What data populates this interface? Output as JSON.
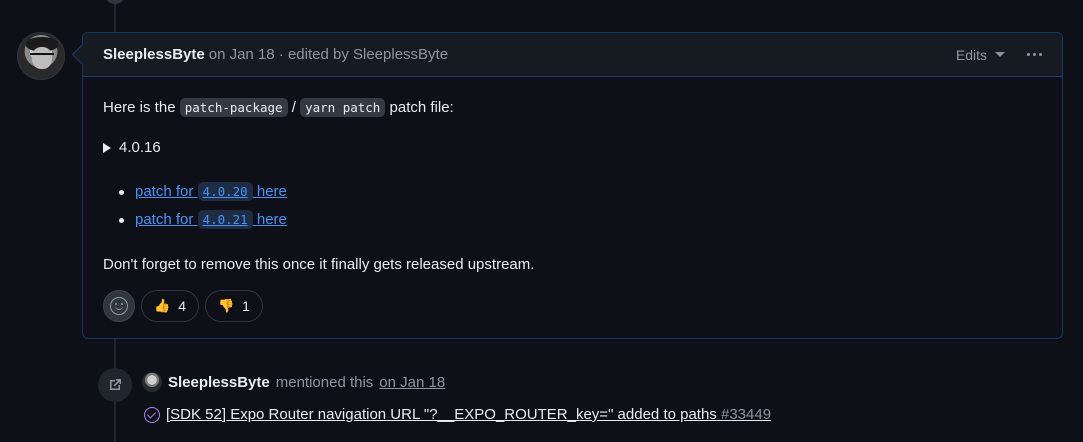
{
  "comment": {
    "author": "SleeplessByte",
    "meta": "on Jan 18 · edited by SleeplessByte",
    "edits_label": "Edits",
    "intro_before": "Here is the",
    "code_patch_package": "patch-package",
    "intro_sep": "/",
    "code_yarn_patch": "yarn patch",
    "intro_after": "patch file:",
    "details_summary": "4.0.16",
    "patches": [
      {
        "prefix": "patch for",
        "version": "4.0.20",
        "suffix": "here"
      },
      {
        "prefix": "patch for",
        "version": "4.0.21",
        "suffix": "here"
      }
    ],
    "reminder": "Don't forget to remove this once it finally gets released upstream.",
    "reactions": [
      {
        "emoji": "👍",
        "count": "4"
      },
      {
        "emoji": "👎",
        "count": "1"
      }
    ]
  },
  "event": {
    "author": "SleeplessByte",
    "action": "mentioned this",
    "date": "on Jan 18",
    "issue_title": "[SDK 52] Expo Router navigation URL \"?__EXPO_ROUTER_key=\" added to paths",
    "issue_number": "#33449"
  },
  "icons": {
    "avatar": "user-avatar",
    "event": "cross-reference-icon",
    "issue": "issue-closed-icon",
    "menu": "kebab-horizontal-icon",
    "add_reaction": "smiley-icon"
  }
}
